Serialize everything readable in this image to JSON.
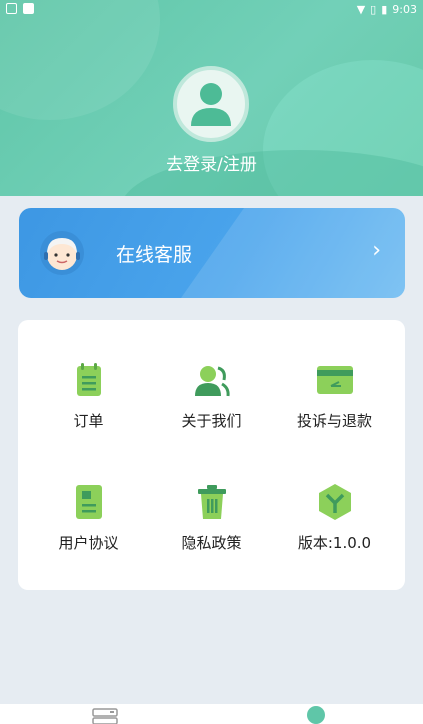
{
  "status_bar": {
    "time": "9:03"
  },
  "header": {
    "login_text": "去登录/注册"
  },
  "service": {
    "label": "在线客服",
    "arrow": "›"
  },
  "menu": {
    "items": [
      {
        "label": "订单",
        "icon": "order-icon"
      },
      {
        "label": "关于我们",
        "icon": "about-us-icon"
      },
      {
        "label": "投诉与退款",
        "icon": "complaint-refund-icon"
      },
      {
        "label": "用户协议",
        "icon": "user-agreement-icon"
      },
      {
        "label": "隐私政策",
        "icon": "privacy-policy-icon"
      },
      {
        "label": "版本:1.0.0",
        "icon": "version-icon"
      }
    ]
  },
  "tabbar": {
    "items": [
      {
        "icon": "home-icon"
      },
      {
        "icon": "profile-icon"
      }
    ]
  },
  "colors": {
    "primary_green": "#5fc6a8",
    "service_blue": "#3d97e3",
    "background": "#e6ecf2"
  }
}
